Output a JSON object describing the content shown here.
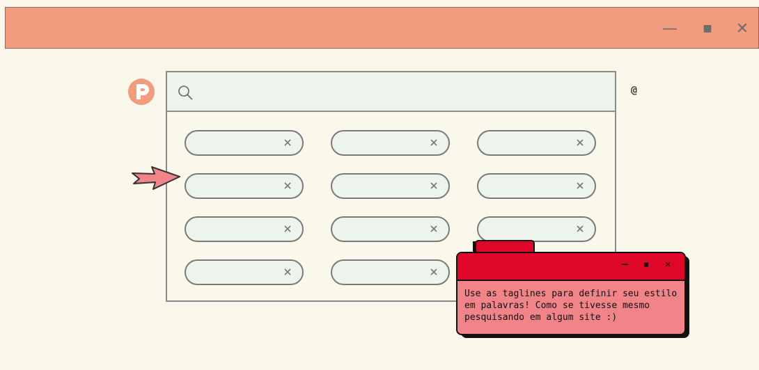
{
  "window": {
    "minimize_glyph": "—",
    "maximize_glyph": "■",
    "close_glyph": "✕"
  },
  "logo": {
    "letter": "P",
    "color": "#f29b7d"
  },
  "search": {
    "value": "",
    "placeholder": ""
  },
  "at_icon": "@",
  "tags": [
    {
      "label": ""
    },
    {
      "label": ""
    },
    {
      "label": ""
    },
    {
      "label": ""
    },
    {
      "label": ""
    },
    {
      "label": ""
    },
    {
      "label": ""
    },
    {
      "label": ""
    },
    {
      "label": ""
    },
    {
      "label": ""
    },
    {
      "label": ""
    }
  ],
  "popup": {
    "minimize_glyph": "—",
    "maximize_glyph": "■",
    "close_glyph": "✕",
    "message": "Use as taglines para definir seu estilo\nem palavras! Como se tivesse mesmo\npesquisando em algum site :)"
  },
  "colors": {
    "titlebar": "#f29b7d",
    "background": "#f9f8ea",
    "pill": "#edf4ec",
    "popup_header": "#df0727",
    "popup_body": "#f08488",
    "arrow": "#f08488"
  }
}
